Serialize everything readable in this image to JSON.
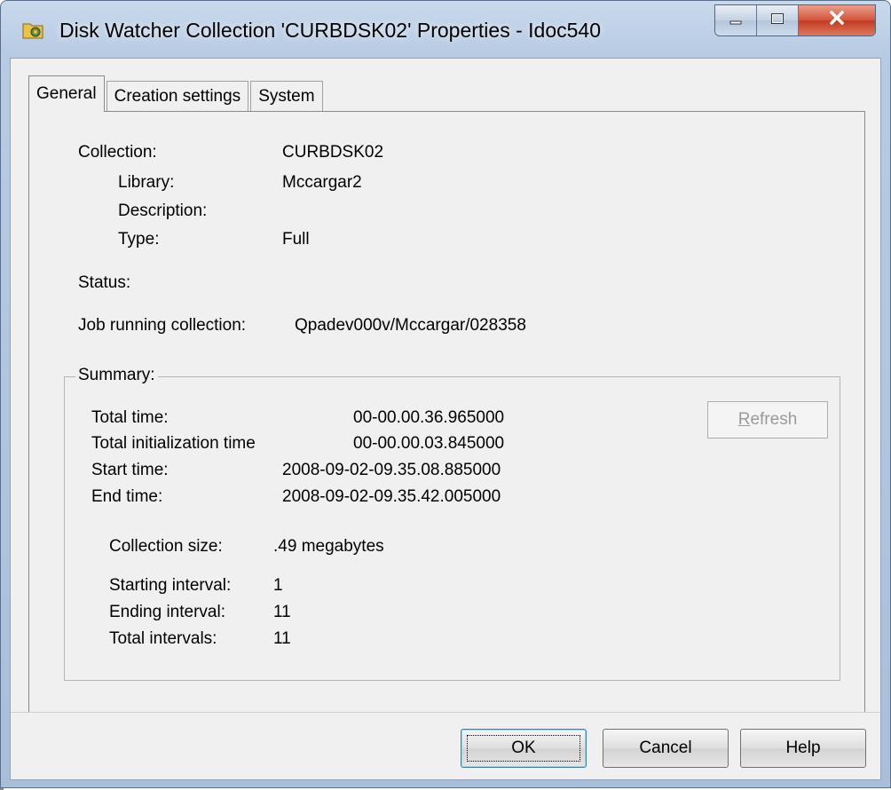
{
  "window": {
    "title": "Disk Watcher Collection 'CURBDSK02' Properties - Idoc540",
    "icon": "folder-gear-icon"
  },
  "caption_buttons": {
    "minimize_icon": "minimize-icon",
    "maximize_icon": "maximize-icon",
    "close_icon": "close-icon"
  },
  "tabs": [
    {
      "label": "General",
      "active": true
    },
    {
      "label": "Creation settings",
      "active": false
    },
    {
      "label": "System",
      "active": false
    }
  ],
  "general": {
    "collection_label": "Collection:",
    "collection_value": "CURBDSK02",
    "library_label": "Library:",
    "library_value": "Mccargar2",
    "description_label": "Description:",
    "description_value": "",
    "type_label": "Type:",
    "type_value": "Full",
    "status_label": "Status:",
    "status_value": "",
    "job_label": "Job running collection:",
    "job_value": "Qpadev000v/Mccargar/028358"
  },
  "summary": {
    "title": "Summary:",
    "total_time_label": "Total time:",
    "total_time_value": "00-00.00.36.965000",
    "total_init_label": "Total initialization time",
    "total_init_value": "00-00.00.03.845000",
    "start_time_label": "Start time:",
    "start_time_value": "2008-09-02-09.35.08.885000",
    "end_time_label": "End time:",
    "end_time_value": "2008-09-02-09.35.42.005000",
    "collection_size_label": "Collection size:",
    "collection_size_value": ".49 megabytes",
    "starting_interval_label": "Starting interval:",
    "starting_interval_value": "1",
    "ending_interval_label": "Ending interval:",
    "ending_interval_value": "11",
    "total_intervals_label": "Total intervals:",
    "total_intervals_value": "11",
    "refresh_label": "Refresh"
  },
  "buttons": {
    "ok": "OK",
    "cancel": "Cancel",
    "help": "Help"
  }
}
